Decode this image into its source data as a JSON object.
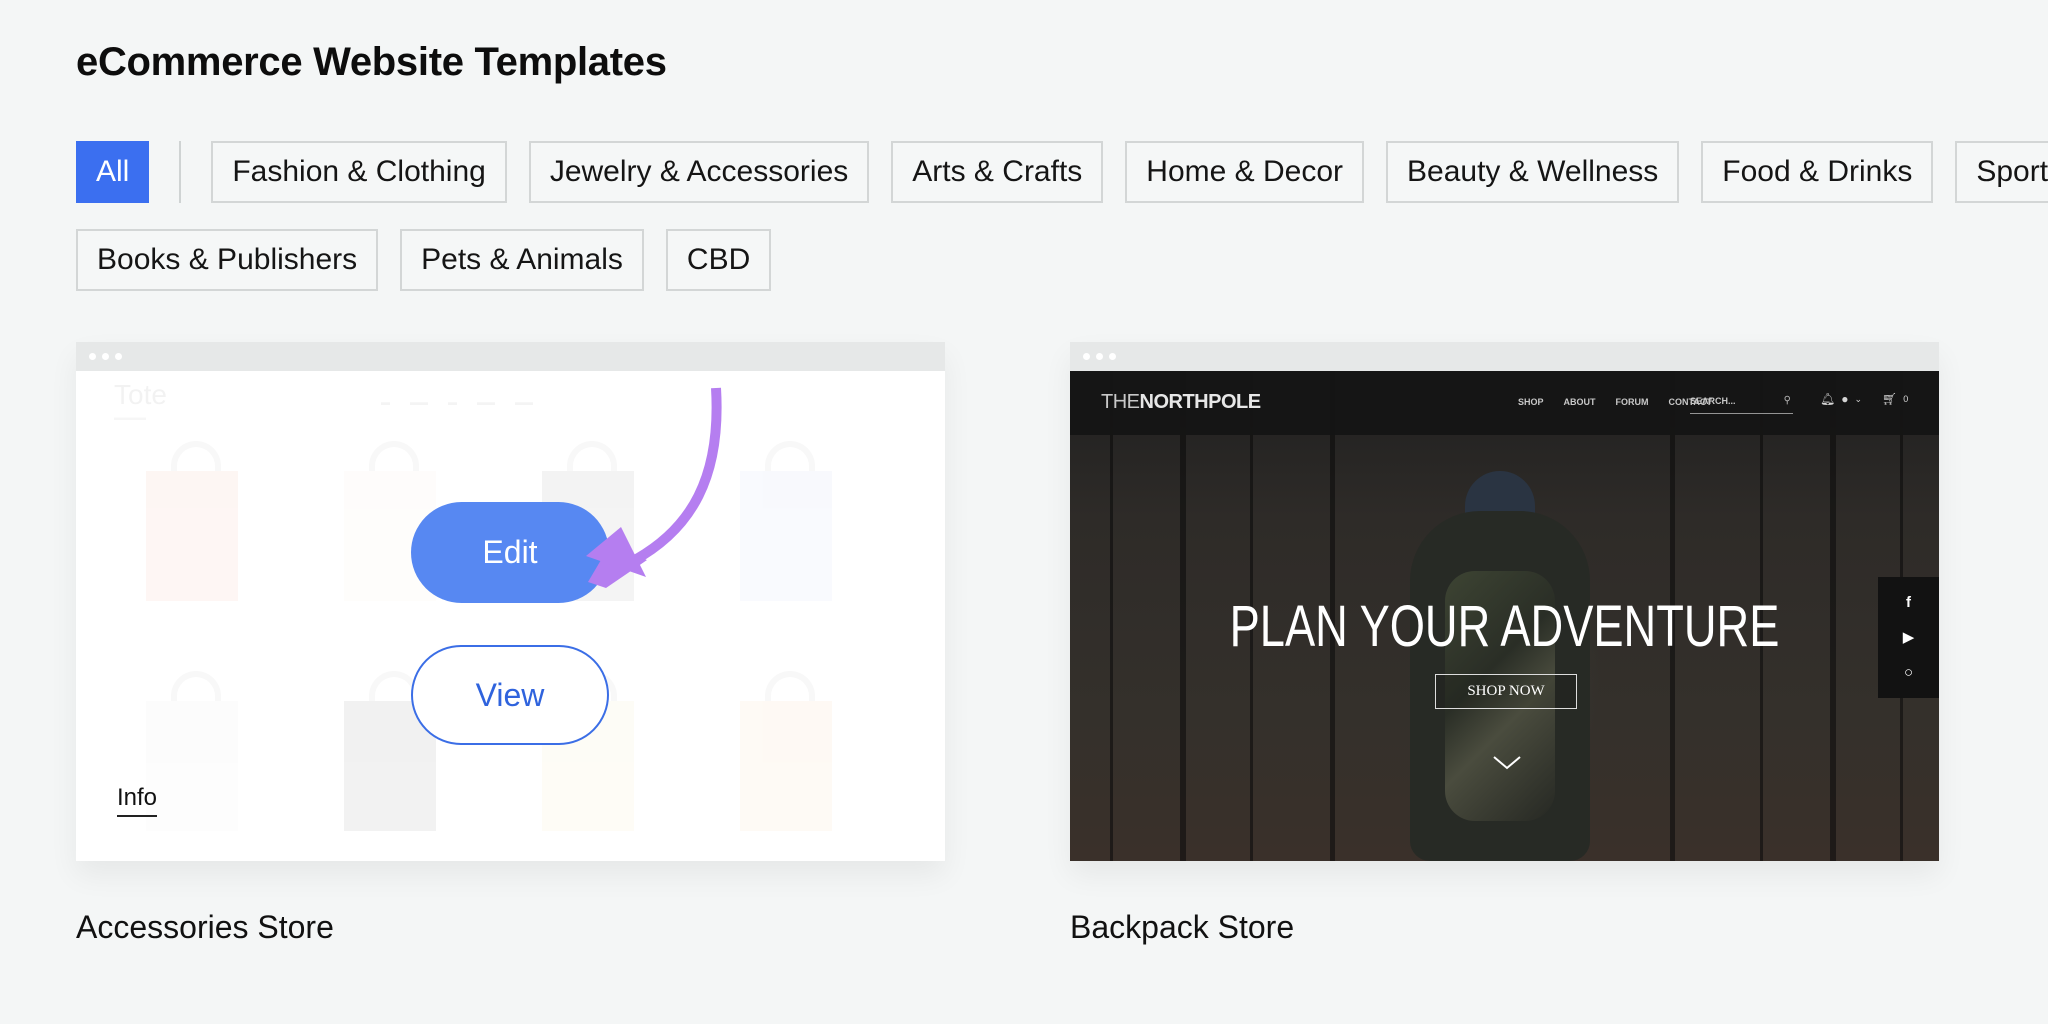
{
  "page": {
    "title": "eCommerce Website Templates"
  },
  "filters": {
    "row1": [
      {
        "label": "All",
        "active": true
      },
      {
        "label": "Fashion & Clothing"
      },
      {
        "label": "Jewelry & Accessories"
      },
      {
        "label": "Arts & Crafts"
      },
      {
        "label": "Home & Decor"
      },
      {
        "label": "Beauty & Wellness"
      },
      {
        "label": "Food & Drinks"
      },
      {
        "label": "Sports &"
      }
    ],
    "row2": [
      {
        "label": "Books & Publishers"
      },
      {
        "label": "Pets & Animals"
      },
      {
        "label": "CBD"
      }
    ]
  },
  "templates": [
    {
      "name": "Accessories Store",
      "preview": {
        "site_logo": "Tote",
        "edit_label": "Edit",
        "view_label": "View",
        "info_label": "Info"
      },
      "arrow_color": "#b57ef0"
    },
    {
      "name": "Backpack Store",
      "preview": {
        "logo_thin": "THE",
        "logo_bold": "NORTHPOLE",
        "nav": [
          "SHOP",
          "ABOUT",
          "FORUM",
          "CONTACT"
        ],
        "search_placeholder": "SEARCH...",
        "cart_count": "0",
        "hero_title": "PLAN YOUR ADVENTURE",
        "cta_label": "SHOP NOW",
        "social": [
          "facebook",
          "youtube",
          "instagram"
        ]
      }
    }
  ],
  "colors": {
    "accent": "#3b6ff0",
    "edit_button": "#5788f2",
    "view_button_text": "#2f63dd",
    "background": "#f4f6f6"
  }
}
